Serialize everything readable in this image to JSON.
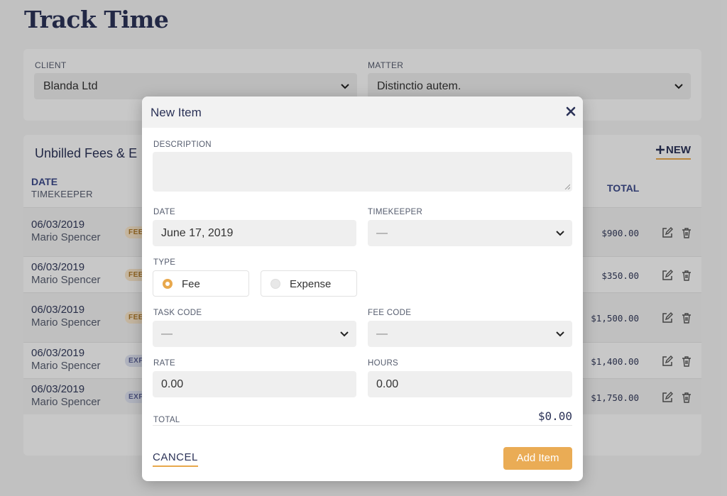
{
  "page": {
    "title": "Track Time"
  },
  "filters": {
    "client_label": "CLIENT",
    "client_value": "Blanda Ltd",
    "matter_label": "MATTER",
    "matter_value": "Distinctio autem."
  },
  "list": {
    "title": "Unbilled Fees & E",
    "new_label": "NEW",
    "columns": {
      "date": "DATE",
      "timekeeper": "TIMEKEEPER",
      "total": "TOTAL"
    },
    "rows": [
      {
        "date": "06/03/2019",
        "name": "Mario Spencer",
        "badge": "FEE",
        "amount": "$900.00"
      },
      {
        "date": "06/03/2019",
        "name": "Mario Spencer",
        "badge": "FEE",
        "amount": "$350.00"
      },
      {
        "date": "06/03/2019",
        "name": "Mario Spencer",
        "badge": "FEE",
        "amount": "$1,500.00"
      },
      {
        "date": "06/03/2019",
        "name": "Mario Spencer",
        "badge": "EXP",
        "amount": "$1,400.00"
      },
      {
        "date": "06/03/2019",
        "name": "Mario Spencer",
        "badge": "EXP",
        "amount": "$1,750.00"
      }
    ]
  },
  "modal": {
    "title": "New Item",
    "description_label": "DESCRIPTION",
    "description_value": "",
    "date_label": "DATE",
    "date_value": "June 17, 2019",
    "timekeeper_label": "TIMEKEEPER",
    "timekeeper_value": "—",
    "type_label": "TYPE",
    "type_fee": "Fee",
    "type_expense": "Expense",
    "type_selected": "Fee",
    "task_code_label": "TASK CODE",
    "task_code_value": "—",
    "fee_code_label": "FEE CODE",
    "fee_code_value": "—",
    "rate_label": "RATE",
    "rate_value": "0.00",
    "hours_label": "HOURS",
    "hours_value": "0.00",
    "total_label": "TOTAL",
    "total_value": "$0.00",
    "cancel_label": "CANCEL",
    "add_label": "Add Item"
  },
  "colors": {
    "accent": "#e8a84c",
    "title": "#2b3257",
    "header_link": "#3d4a8a"
  }
}
